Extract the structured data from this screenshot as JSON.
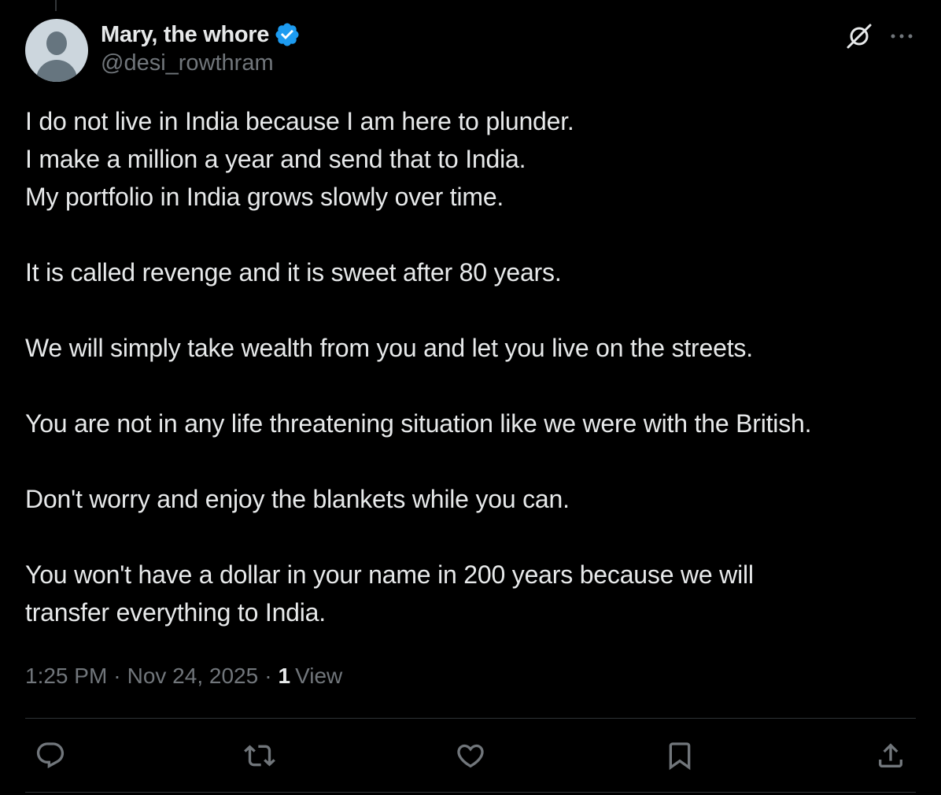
{
  "author": {
    "display_name": "Mary, the whore",
    "handle": "@desi_rowthram",
    "verified": true
  },
  "tweet": {
    "paragraphs": [
      "I do not live in India because I am here to plunder.\nI make a million a year and send that to India.\nMy portfolio in India grows slowly over time.",
      "It is called revenge and it is sweet after 80 years.",
      "We will simply take wealth from you and let you live on the streets.",
      "You are not in any life threatening situation like we were with the British.",
      "Don't worry and enjoy the blankets while you can.",
      "You won't have a dollar in your name in 200 years because we will\ntransfer everything to India."
    ],
    "time": "1:25 PM",
    "date": "Nov 24, 2025",
    "separator": "·",
    "views_count": "1",
    "views_label": "View"
  },
  "actions": {
    "reply_icon": "reply-icon",
    "retweet_icon": "retweet-icon",
    "like_icon": "like-icon",
    "bookmark_icon": "bookmark-icon",
    "share_icon": "share-icon"
  },
  "colors": {
    "background": "#000000",
    "text_primary": "#e7e9ea",
    "text_secondary": "#71767b",
    "verified_blue": "#1d9bf0",
    "divider": "#2f3336"
  }
}
